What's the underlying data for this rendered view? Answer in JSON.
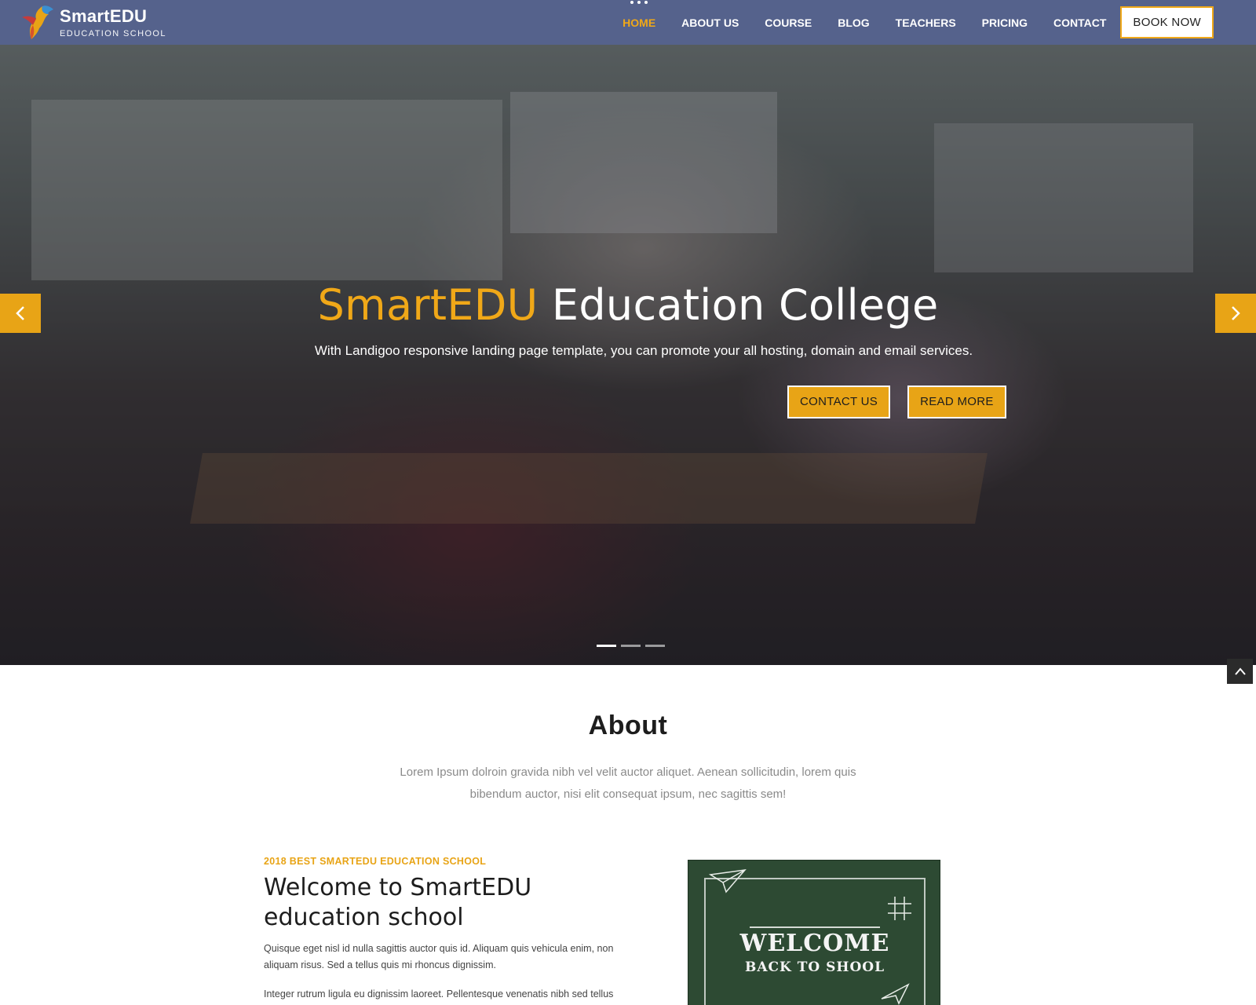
{
  "brand": {
    "name": "SmartEDU",
    "tagline": "EDUCATION SCHOOL"
  },
  "nav": {
    "items": [
      {
        "label": "HOME",
        "active": true
      },
      {
        "label": "ABOUT US",
        "active": false
      },
      {
        "label": "COURSE",
        "active": false
      },
      {
        "label": "BLOG",
        "active": false
      },
      {
        "label": "TEACHERS",
        "active": false
      },
      {
        "label": "PRICING",
        "active": false
      },
      {
        "label": "CONTACT",
        "active": false
      }
    ],
    "book_label": "BOOK NOW"
  },
  "hero": {
    "title_accent": "SmartEDU",
    "title_rest": " Education College",
    "subtitle": "With Landigoo responsive landing page template, you can promote your all hosting, domain and email services.",
    "contact_label": "CONTACT US",
    "read_more_label": "READ MORE",
    "slides_count": 3,
    "active_slide": 1
  },
  "about": {
    "title": "About",
    "text": "Lorem Ipsum dolroin gravida nibh vel velit auctor aliquet. Aenean sollicitudin, lorem quis bibendum auctor, nisi elit consequat ipsum, nec sagittis sem!",
    "kicker": "2018 BEST SMARTEDU EDUCATION SCHOOL",
    "heading": "Welcome to SmartEDU education school",
    "para1": "Quisque eget nisl id nulla sagittis auctor quis id. Aliquam quis vehicula enim, non aliquam risus. Sed a tellus quis mi rhoncus dignissim.",
    "para2": "Integer rutrum ligula eu dignissim laoreet. Pellentesque venenatis nibh sed tellus",
    "chalkboard_line1": "WELCOME",
    "chalkboard_line2": "BACK TO SHOOL"
  },
  "colors": {
    "header_bg": "#55628c",
    "accent": "#e8a416",
    "nav_active": "#f0a818",
    "chalkboard": "#2d4a33"
  },
  "icons": {
    "logo": "bird-logo-icon",
    "prev": "chevron-left-icon",
    "next": "chevron-right-icon",
    "to_top": "chevron-up-icon"
  }
}
